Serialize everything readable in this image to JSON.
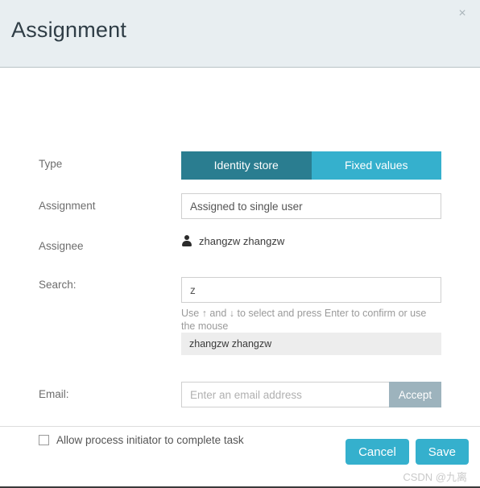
{
  "dialog": {
    "title": "Assignment",
    "close_label": "×"
  },
  "form": {
    "type": {
      "label": "Type",
      "options": [
        {
          "label": "Identity store",
          "active": true
        },
        {
          "label": "Fixed values",
          "active": false
        }
      ]
    },
    "assignment": {
      "label": "Assignment",
      "value": "Assigned to single user"
    },
    "assignee": {
      "label": "Assignee",
      "icon": "user-icon",
      "name": "zhangzw zhangzw"
    },
    "search": {
      "label": "Search:",
      "value": "z",
      "hint": "Use ↑ and ↓ to select and press Enter to confirm or use the mouse",
      "suggestions": [
        "zhangzw zhangzw"
      ]
    },
    "email": {
      "label": "Email:",
      "placeholder": "Enter an email address",
      "value": "",
      "accept_label": "Accept"
    },
    "initiator_checkbox": {
      "label": "Allow process initiator to complete task",
      "checked": false
    }
  },
  "footer": {
    "cancel_label": "Cancel",
    "save_label": "Save",
    "watermark": "CSDN @九离"
  },
  "colors": {
    "header_bg": "#e8eef1",
    "active_toggle": "#2a7d90",
    "inactive_toggle": "#35b0cd",
    "accept_button": "#9db3bd",
    "primary_button": "#35b0cd",
    "suggestion_bg": "#ededed"
  }
}
